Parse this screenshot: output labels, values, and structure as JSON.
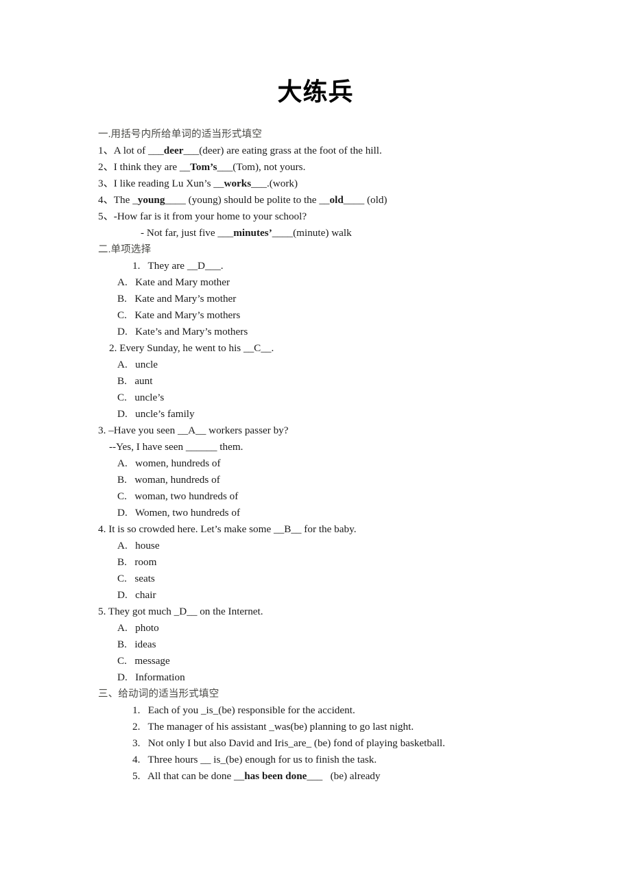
{
  "document": {
    "title": "大练兵"
  },
  "sections": [
    {
      "heading": "一.用括号内所给单词的适当形式填空",
      "items": [
        {
          "pre": "1、A lot of ___",
          "answer": "deer",
          "post": "___(deer) are eating grass at the foot of the hill."
        },
        {
          "pre": "2、I think they are __",
          "answer": "Tom’s",
          "post": "___(Tom), not yours."
        },
        {
          "pre": "3、I like reading Lu Xun’s __",
          "answer": "works",
          "post": "___.(work)"
        },
        {
          "pre": "4、The _",
          "answer": "young",
          "post": "____ (young) should be polite to the __",
          "answer2": "old",
          "post2": "____ (old)"
        },
        {
          "pre": "5、-How far is it from your home to your school?",
          "answer": "",
          "post": ""
        },
        {
          "pre": "- Not far, just five ___",
          "answer": "minutes’",
          "post": "____(minute) walk"
        }
      ]
    },
    {
      "heading": "二.单项选择",
      "questions": [
        {
          "stem": "1.   They are __D___.",
          "options": [
            "A.   Kate and Mary mother",
            "B.   Kate and Mary’s mother",
            "C.   Kate and Mary’s mothers",
            "D.   Kate’s and Mary’s mothers"
          ]
        },
        {
          "stem": "2. Every Sunday, he went to his __C__.",
          "options": [
            "A.   uncle",
            "B.   aunt",
            "C.   uncle’s",
            "D.   uncle’s family"
          ]
        },
        {
          "stem": "3. –Have you seen __A__ workers passer by?",
          "stem2": "--Yes, I have seen ______ them.",
          "options": [
            "A.   women, hundreds of",
            "B.   woman, hundreds of",
            "C.   woman, two hundreds of",
            "D.   Women, two hundreds of"
          ]
        },
        {
          "stem": "4. It is so crowded here. Let’s make some __B__ for the baby.",
          "options": [
            "A.   house",
            "B.   room",
            "C.   seats",
            "D.   chair"
          ]
        },
        {
          "stem": "5. They got much _D__ on the Internet.",
          "options": [
            "A.   photo",
            "B.   ideas",
            "C.   message",
            "D.   Information"
          ]
        }
      ]
    },
    {
      "heading": "三、给动词的适当形式填空",
      "items": [
        {
          "pre": "1.   Each of you _is_(be) responsible for the accident.",
          "answer": "",
          "post": ""
        },
        {
          "pre": "2.   The manager of his assistant _was(be) planning to go last night.",
          "answer": "",
          "post": ""
        },
        {
          "pre": "3.   Not only I but also David and Iris_are_ (be) fond of playing basketball.",
          "answer": "",
          "post": ""
        },
        {
          "pre": "4.   Three hours __ is_(be) enough for us to finish the task.",
          "answer": "",
          "post": ""
        },
        {
          "pre": "5.   All that can be done __",
          "answer": "has been done",
          "post": "___   (be) already"
        }
      ]
    }
  ]
}
